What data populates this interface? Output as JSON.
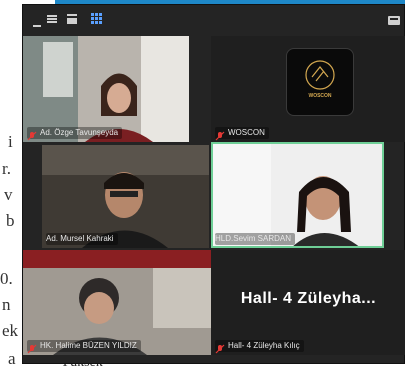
{
  "background_doc": {
    "fragments": [
      "i",
      "r.",
      "v",
      "b",
      "0.",
      "n",
      "ek",
      "a",
      "Yüksek"
    ]
  },
  "toolbar": {
    "icons": [
      "minimize-icon",
      "menu-icon",
      "speaker-view-icon",
      "gallery-view-icon",
      "more-icon"
    ]
  },
  "participants": [
    {
      "name": "Ad. Özge Tavunşeyda",
      "video": true,
      "muted": true,
      "active": false
    },
    {
      "name": "WOSCON",
      "video": false,
      "logo": true,
      "logo_text": "WOSCON",
      "muted": true,
      "active": false
    },
    {
      "name": "Ad. Mursel Kahraki",
      "video": true,
      "muted": false,
      "active": false
    },
    {
      "name": "HLD.Sevim SARDAN",
      "video": true,
      "muted": false,
      "active": true
    },
    {
      "name": "HK. Halime BÜZEN YILDIZ",
      "video": true,
      "muted": true,
      "active": false
    },
    {
      "name": "Hall- 4 Züleyha Kılıç",
      "video": false,
      "display_name": "Hall- 4 Züleyha...",
      "muted": true,
      "active": false
    }
  ],
  "colors": {
    "window_bg": "#242424",
    "active_border": "#6fcf97",
    "muted_icon": "#e53935",
    "accent_bar": "#1e88c8"
  }
}
